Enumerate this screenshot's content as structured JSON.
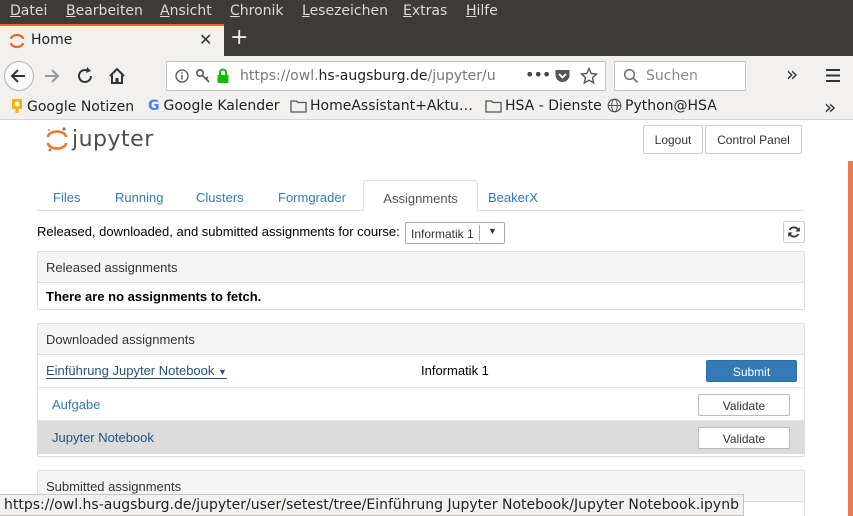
{
  "menubar": {
    "items": [
      {
        "label": "Datei"
      },
      {
        "label": "Bearbeiten"
      },
      {
        "label": "Ansicht"
      },
      {
        "label": "Chronik"
      },
      {
        "label": "Lesezeichen"
      },
      {
        "label": "Extras"
      },
      {
        "label": "Hilfe"
      }
    ]
  },
  "browser": {
    "tab_title": "Home",
    "url_prefix": "https://owl.",
    "url_host": "hs-augsburg.de",
    "url_path": "/jupyter/u",
    "search_placeholder": "Suchen",
    "accent_color": "#e66a1a"
  },
  "bookmarks": [
    {
      "label": "Google Notizen",
      "icon": "lightbulb-icon"
    },
    {
      "label": "Google Kalender",
      "icon": "google-icon"
    },
    {
      "label": "HomeAssistant+Aktu…",
      "icon": "folder-icon"
    },
    {
      "label": "HSA - Dienste",
      "icon": "folder-icon"
    },
    {
      "label": "Python@HSA",
      "icon": "globe-icon"
    }
  ],
  "jupyter": {
    "logo_text": "jupyter",
    "logout_label": "Logout",
    "control_panel_label": "Control Panel",
    "tabs": [
      {
        "label": "Files"
      },
      {
        "label": "Running"
      },
      {
        "label": "Clusters"
      },
      {
        "label": "Formgrader"
      },
      {
        "label": "Assignments",
        "active": true
      },
      {
        "label": "BeakerX"
      }
    ],
    "course_label": "Released, downloaded, and submitted assignments for course:",
    "course_selected": "Informatik 1",
    "released": {
      "title": "Released assignments",
      "empty_text": "There are no assignments to fetch."
    },
    "downloaded": {
      "title": "Downloaded assignments",
      "assignment_name": "Einführung Jupyter Notebook",
      "course": "Informatik 1",
      "submit_label": "Submit",
      "files": [
        {
          "name": "Aufgabe",
          "validate_label": "Validate"
        },
        {
          "name": "Jupyter Notebook",
          "validate_label": "Validate"
        }
      ]
    },
    "submitted": {
      "title": "Submitted assignments"
    },
    "primary_color": "#337ab7"
  },
  "statusbar": {
    "url": "https://owl.hs-augsburg.de/jupyter/user/setest/tree/Einführung Jupyter Notebook/Jupyter Notebook.ipynb"
  }
}
